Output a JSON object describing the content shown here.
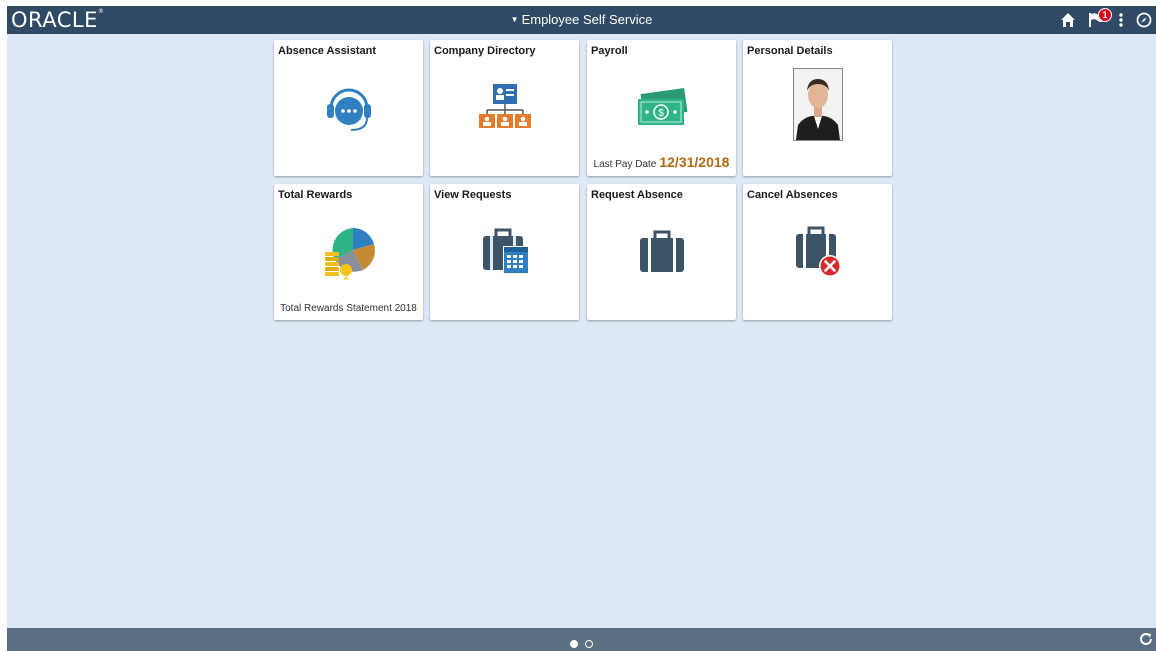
{
  "header": {
    "logo": "ORACLE",
    "title": "Employee Self Service",
    "notification_count": "1"
  },
  "tiles": [
    {
      "title": "Absence Assistant",
      "icon": "headset-chat-icon"
    },
    {
      "title": "Company Directory",
      "icon": "org-chart-icon"
    },
    {
      "title": "Payroll",
      "icon": "money-icon",
      "footer_label": "Last Pay Date",
      "footer_value": "12/31/2018"
    },
    {
      "title": "Personal Details",
      "icon": "profile-photo"
    },
    {
      "title": "Total Rewards",
      "icon": "pie-coins-icon",
      "footer_label": "Total Rewards Statement 2018"
    },
    {
      "title": "View Requests",
      "icon": "briefcase-calendar-icon"
    },
    {
      "title": "Request Absence",
      "icon": "briefcase-icon"
    },
    {
      "title": "Cancel Absences",
      "icon": "briefcase-cancel-icon"
    }
  ],
  "pager": {
    "pages": 2,
    "current": 1
  },
  "colors": {
    "header_bg": "#2f4a64",
    "page_bg": "#dde9f5",
    "footer_bg": "#5a6f82",
    "accent_orange": "#e57c2c",
    "accent_blue": "#2f7fc1",
    "money_green": "#2fb48a",
    "briefcase": "#3d5366",
    "paydate": "#b06a14"
  }
}
